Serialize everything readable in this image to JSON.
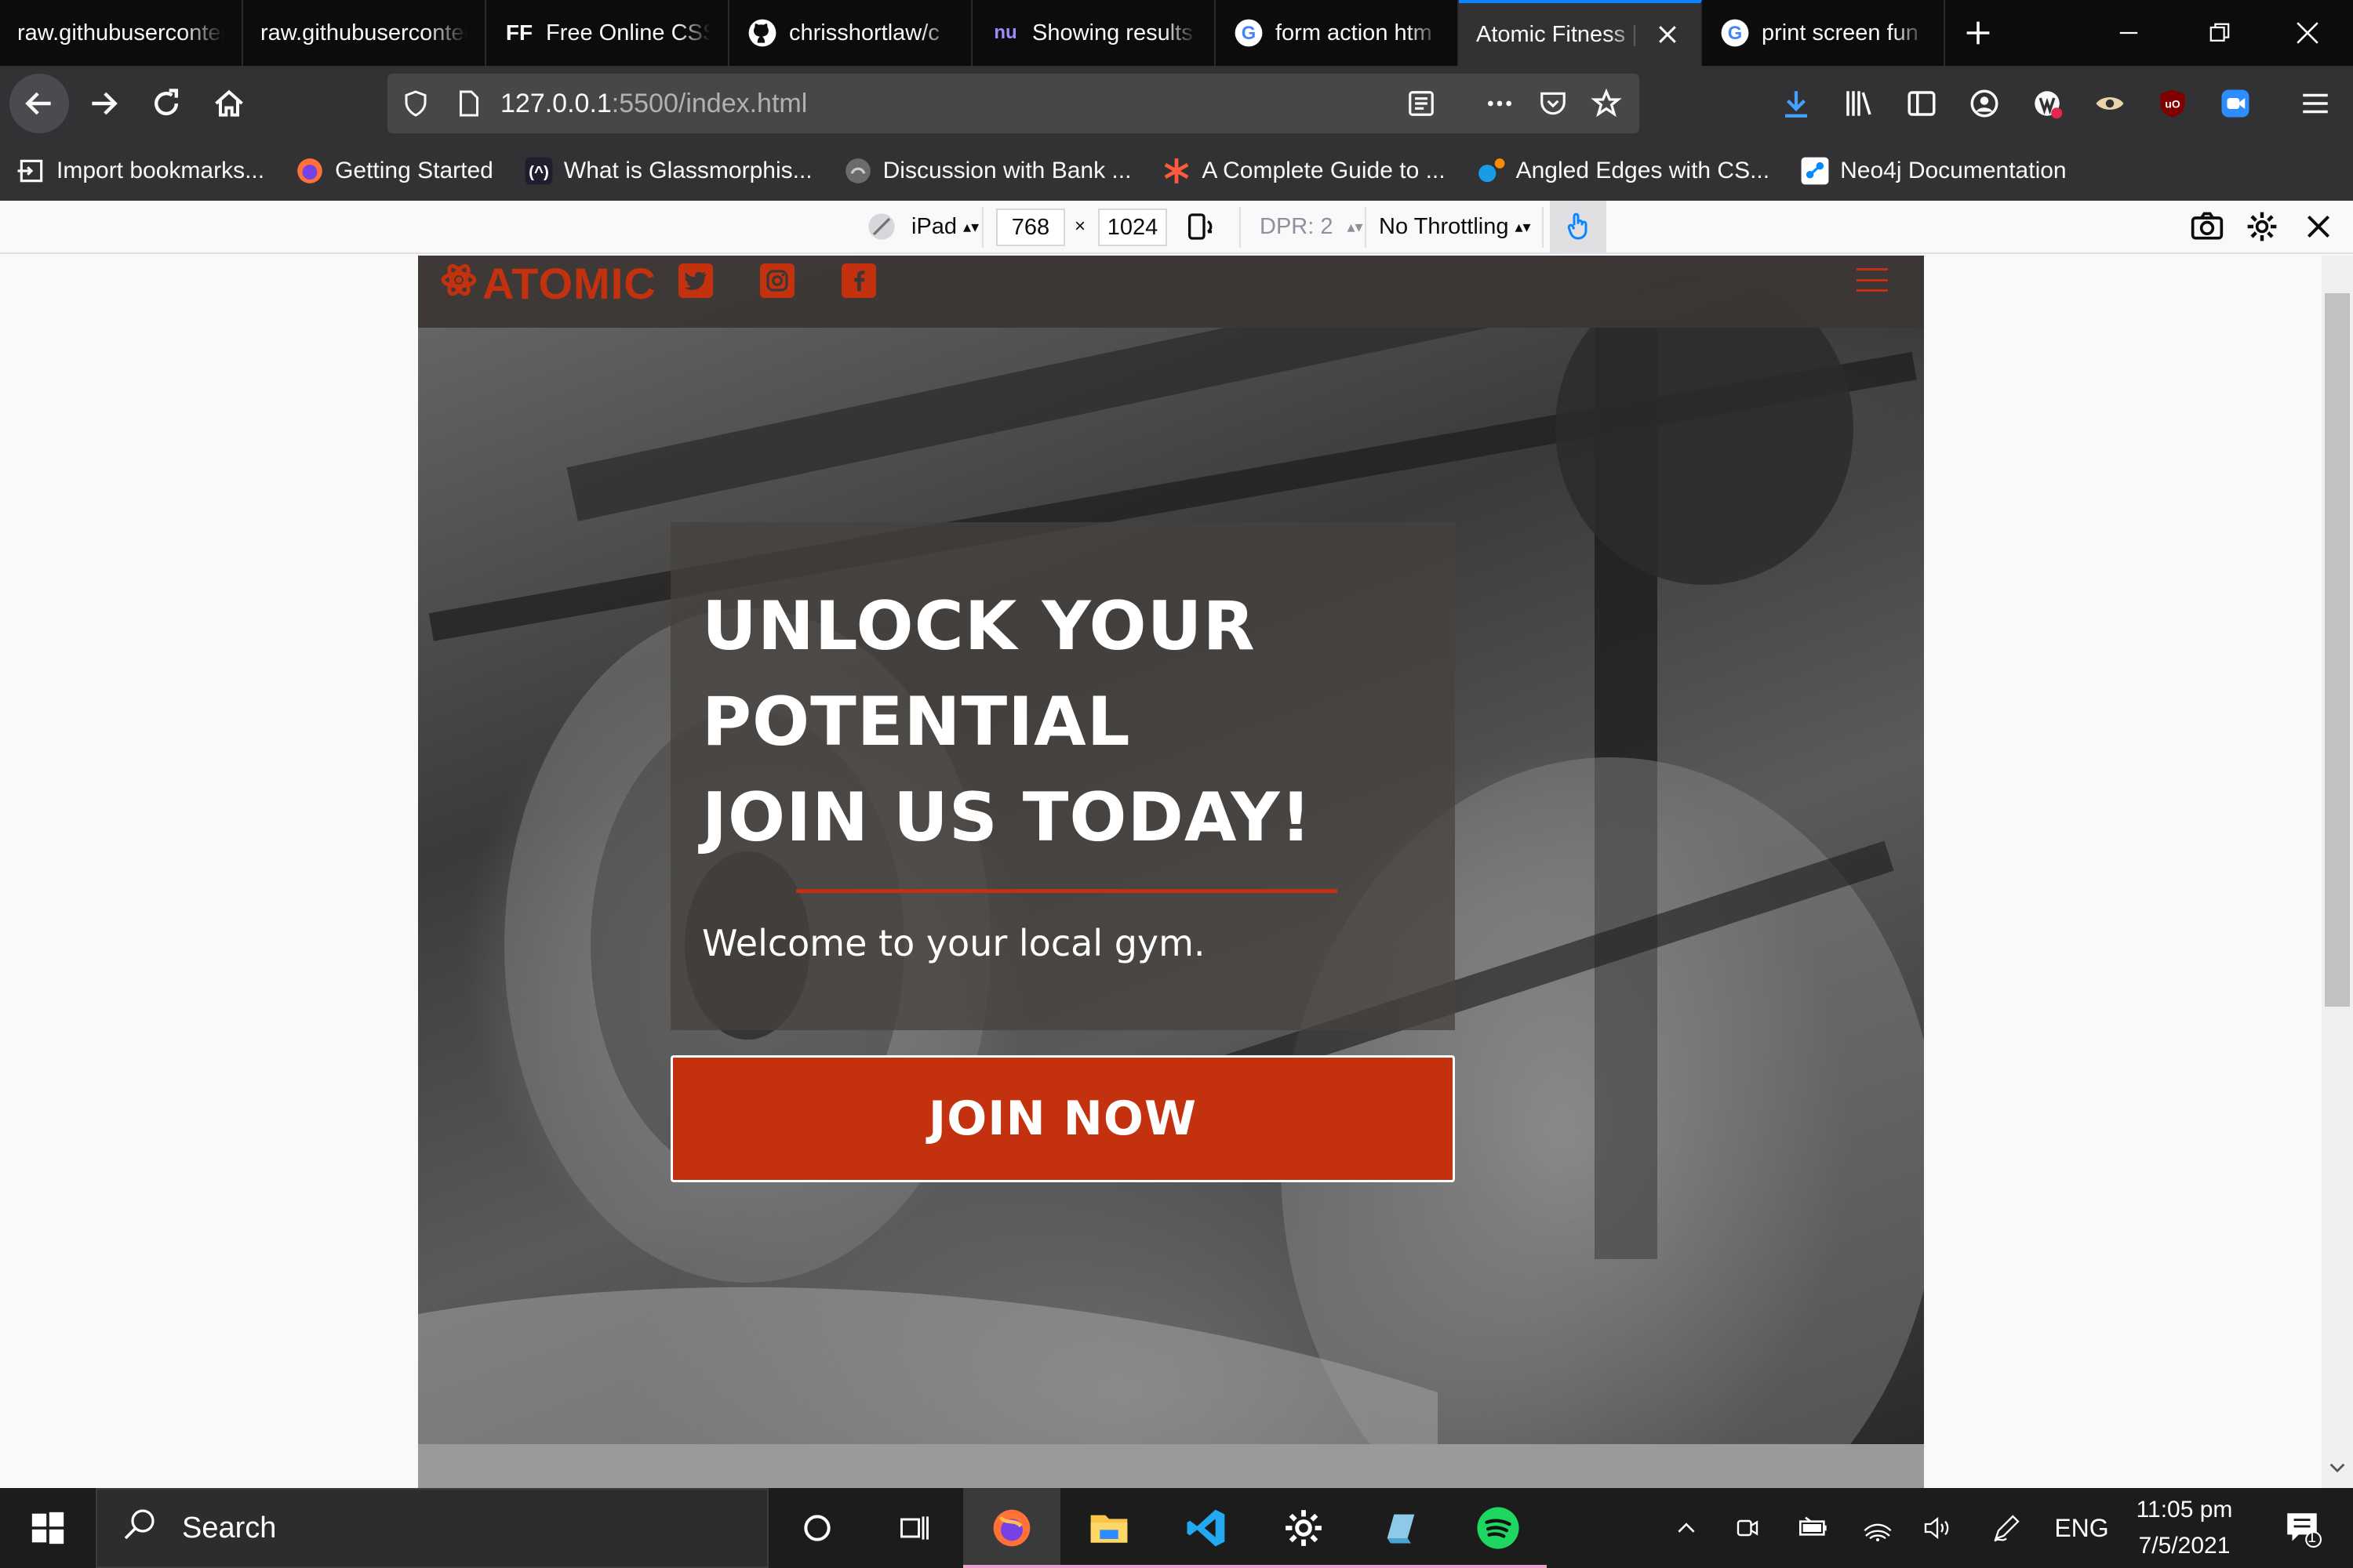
{
  "browser": {
    "tabs": [
      {
        "title": "raw.githubusercontent.com",
        "favicon": "none",
        "active": false
      },
      {
        "title": "raw.githubusercontent.com",
        "favicon": "none",
        "active": false
      },
      {
        "title": "Free Online CSS",
        "favicon": "FF",
        "active": false
      },
      {
        "title": "chrisshortlaw/c",
        "favicon": "github-icon",
        "active": false
      },
      {
        "title": "Showing results",
        "favicon": "nu",
        "active": false
      },
      {
        "title": "form action htm",
        "favicon": "google-icon",
        "active": false
      },
      {
        "title": "Atomic Fitness |",
        "favicon": "none",
        "active": true
      },
      {
        "title": "print screen fun",
        "favicon": "google-icon",
        "active": false
      }
    ],
    "url_host": "127.0.0.1",
    "url_path": ":5500/index.html",
    "bookmarks": [
      {
        "label": "Import bookmarks...",
        "icon": "import-icon"
      },
      {
        "label": "Getting Started",
        "icon": "firefox-icon"
      },
      {
        "label": "What is Glassmorphis...",
        "icon": "devsite-icon"
      },
      {
        "label": "Discussion with Bank ...",
        "icon": "globe-icon"
      },
      {
        "label": "A Complete Guide to ...",
        "icon": "asterisk-icon"
      },
      {
        "label": "Angled Edges with CS...",
        "icon": "dots-icon"
      },
      {
        "label": "Neo4j Documentation",
        "icon": "neo4j-icon"
      }
    ]
  },
  "rdm": {
    "device": "iPad",
    "width": "768",
    "times": "×",
    "height": "1024",
    "dpr": "DPR: 2",
    "throttling": "No Throttling"
  },
  "site": {
    "logo": "ATOMIC",
    "headline_lines": [
      "UNLOCK YOUR",
      "POTENTIAL",
      "JOIN US TODAY!"
    ],
    "tagline": "Welcome to your local gym.",
    "cta": "JOIN NOW",
    "accent": "#c4310e"
  },
  "taskbar": {
    "search_placeholder": "Search",
    "lang": "ENG",
    "time": "11:05 pm",
    "date": "7/5/2021",
    "notifications": "1"
  }
}
